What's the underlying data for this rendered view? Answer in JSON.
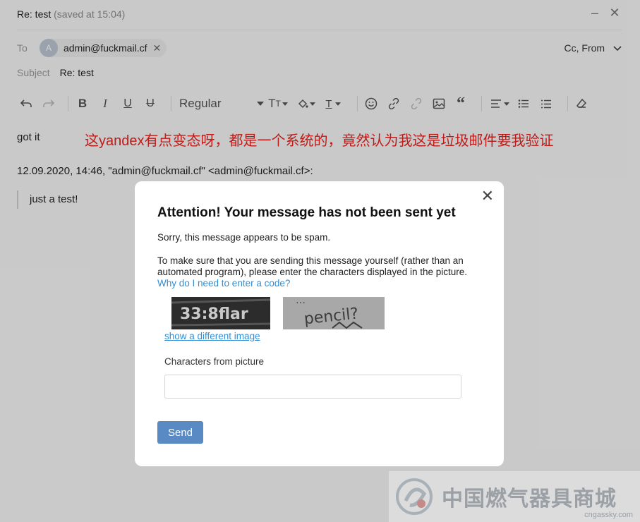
{
  "window": {
    "title": "Re: test",
    "saved": "(saved at 15:04)",
    "minimize_glyph": "–",
    "close_glyph": "✕"
  },
  "header": {
    "to_label": "To",
    "avatar_letter": "A",
    "recipient": "admin@fuckmail.cf",
    "remove_glyph": "✕",
    "cc_from": "Cc, From",
    "subject_label": "Subject",
    "subject": "Re: test"
  },
  "toolbar": {
    "font_style": "Regular",
    "icons": [
      "undo-icon",
      "redo-icon",
      "bold-icon",
      "italic-icon",
      "underline-icon",
      "strikethrough-icon",
      "font-size-icon",
      "fill-color-icon",
      "text-color-icon",
      "emoji-icon",
      "link-icon",
      "unlink-icon",
      "image-icon",
      "quote-icon",
      "align-icon",
      "bullet-list-icon",
      "numbered-list-icon",
      "clear-format-icon"
    ]
  },
  "message": {
    "body": "got it",
    "annotation": "这yandex有点变态呀，都是一个系统的，竟然认为我这是垃圾邮件要我验证",
    "quote_header": "12.09.2020, 14:46, \"admin@fuckmail.cf\" <admin@fuckmail.cf>:",
    "quote_text": "just a test!"
  },
  "dialog": {
    "title": "Attention! Your message has not been sent yet",
    "sorry": "Sorry, this message appears to be spam.",
    "instructions": "To make sure that you are sending this message yourself (rather than an automated program), please enter the characters displayed in the picture.",
    "why_link": "Why do I need to enter a code?",
    "captcha1_text": "33:8flar",
    "captcha2_line1": "…",
    "captcha2_line2": "pencil?",
    "different_image": "show a different image",
    "chars_label": "Characters from picture",
    "input_value": "",
    "send": "Send",
    "close_glyph": "✕"
  },
  "watermark": {
    "text": "中国燃气器具商城",
    "url": "cngassky.com"
  },
  "colors": {
    "accent": "#2e8fd6",
    "send_button": "#5a8ac4",
    "annotation": "#e8231f"
  }
}
